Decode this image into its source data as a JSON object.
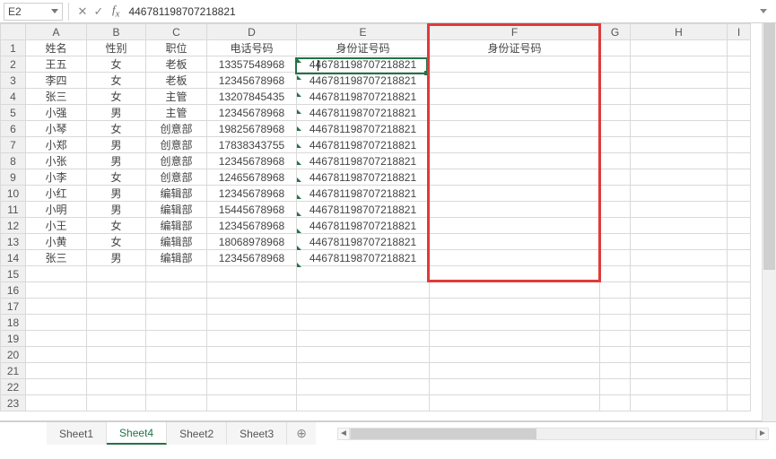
{
  "namebox": "E2",
  "formula": "446781198707218821",
  "cols": [
    {
      "key": "A",
      "w": 68,
      "label": "A"
    },
    {
      "key": "B",
      "w": 66,
      "label": "B"
    },
    {
      "key": "C",
      "w": 68,
      "label": "C"
    },
    {
      "key": "D",
      "w": 100,
      "label": "D"
    },
    {
      "key": "E",
      "w": 148,
      "label": "E"
    },
    {
      "key": "F",
      "w": 190,
      "label": "F"
    },
    {
      "key": "G",
      "w": 34,
      "label": "G"
    },
    {
      "key": "H",
      "w": 108,
      "label": "H"
    },
    {
      "key": "I",
      "w": 26,
      "label": "I"
    }
  ],
  "headers": {
    "A": "姓名",
    "B": "性别",
    "C": "职位",
    "D": "电话号码",
    "E": "身份证号码",
    "F": "身份证号码"
  },
  "rows": [
    {
      "r": 2,
      "A": "王五",
      "B": "女",
      "C": "老板",
      "D": "13357548968",
      "E": "446781198707218821"
    },
    {
      "r": 3,
      "A": "李四",
      "B": "女",
      "C": "老板",
      "D": "12345678968",
      "E": "446781198707218821"
    },
    {
      "r": 4,
      "A": "张三",
      "B": "女",
      "C": "主管",
      "D": "13207845435",
      "E": "446781198707218821"
    },
    {
      "r": 5,
      "A": "小强",
      "B": "男",
      "C": "主管",
      "D": "12345678968",
      "E": "446781198707218821"
    },
    {
      "r": 6,
      "A": "小琴",
      "B": "女",
      "C": "创意部",
      "D": "19825678968",
      "E": "446781198707218821"
    },
    {
      "r": 7,
      "A": "小郑",
      "B": "男",
      "C": "创意部",
      "D": "17838343755",
      "E": "446781198707218821"
    },
    {
      "r": 8,
      "A": "小张",
      "B": "男",
      "C": "创意部",
      "D": "12345678968",
      "E": "446781198707218821"
    },
    {
      "r": 9,
      "A": "小李",
      "B": "女",
      "C": "创意部",
      "D": "12465678968",
      "E": "446781198707218821"
    },
    {
      "r": 10,
      "A": "小红",
      "B": "男",
      "C": "编辑部",
      "D": "12345678968",
      "E": "446781198707218821"
    },
    {
      "r": 11,
      "A": "小明",
      "B": "男",
      "C": "编辑部",
      "D": "15445678968",
      "E": "446781198707218821"
    },
    {
      "r": 12,
      "A": "小王",
      "B": "女",
      "C": "编辑部",
      "D": "12345678968",
      "E": "446781198707218821"
    },
    {
      "r": 13,
      "A": "小黄",
      "B": "女",
      "C": "编辑部",
      "D": "18068978968",
      "E": "446781198707218821"
    },
    {
      "r": 14,
      "A": "张三",
      "B": "男",
      "C": "编辑部",
      "D": "12345678968",
      "E": "446781198707218821"
    }
  ],
  "totalVisibleRows": 23,
  "tabs": [
    {
      "name": "Sheet1",
      "active": false
    },
    {
      "name": "Sheet4",
      "active": true
    },
    {
      "name": "Sheet2",
      "active": false
    },
    {
      "name": "Sheet3",
      "active": false
    }
  ],
  "selectedCell": {
    "col": "E",
    "row": 2
  },
  "redBox": {
    "startCol": "F",
    "endCol": "F",
    "startRow": 0,
    "endRow": 14
  }
}
